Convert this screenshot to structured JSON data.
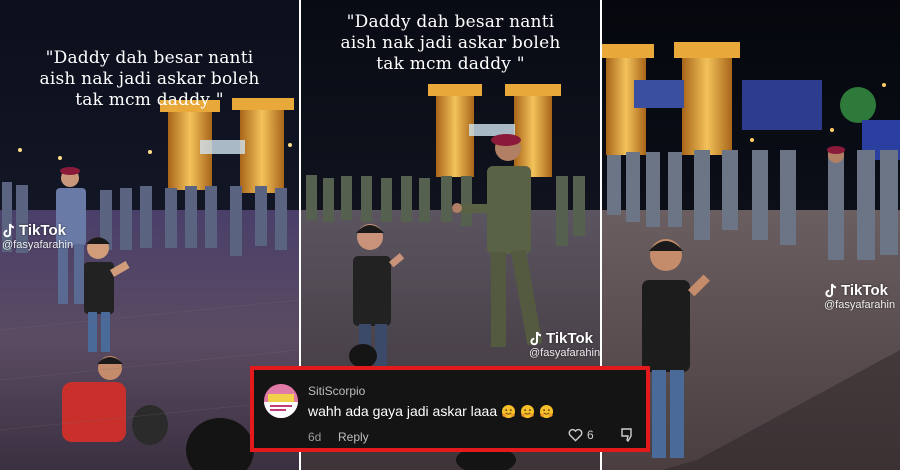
{
  "caption_lines": [
    "\"Daddy dah besar nanti",
    "aish nak jadi askar boleh",
    "tak mcm daddy \""
  ],
  "watermark": {
    "brand": "TikTok",
    "handle": "@fasyafarahin"
  },
  "comment": {
    "username": "SitiScorpio",
    "text": "wahh ada gaya jadi askar laaa",
    "emojis": [
      "hugging-face-icon",
      "hugging-face-icon",
      "hugging-face-icon"
    ],
    "age": "6d",
    "reply_label": "Reply",
    "like_count": "6"
  },
  "colors": {
    "highlight_border": "#e3191c",
    "card_bg": "#141414",
    "beret": "#8b1a3a"
  }
}
